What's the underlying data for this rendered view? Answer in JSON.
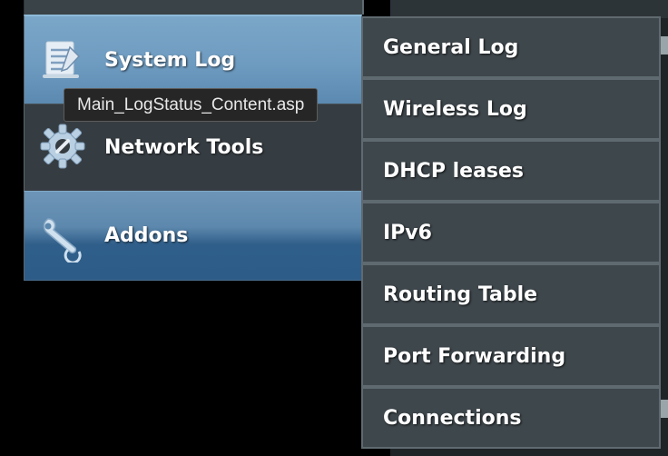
{
  "sidebar": {
    "items": [
      {
        "label": "System Log",
        "icon": "system-log-icon"
      },
      {
        "label": "Network Tools",
        "icon": "gear-wrench-icon"
      },
      {
        "label": "Addons",
        "icon": "wrench-icon"
      }
    ]
  },
  "tooltip": {
    "text": "Main_LogStatus_Content.asp"
  },
  "submenu": {
    "items": [
      {
        "label": "General Log"
      },
      {
        "label": "Wireless Log"
      },
      {
        "label": "DHCP leases"
      },
      {
        "label": "IPv6"
      },
      {
        "label": "Routing Table"
      },
      {
        "label": "Port Forwarding"
      },
      {
        "label": "Connections"
      }
    ]
  },
  "colors": {
    "selected_item": "#6e9bc0",
    "menu_bg": "#3e474c",
    "menu_border": "#5f6a70"
  }
}
